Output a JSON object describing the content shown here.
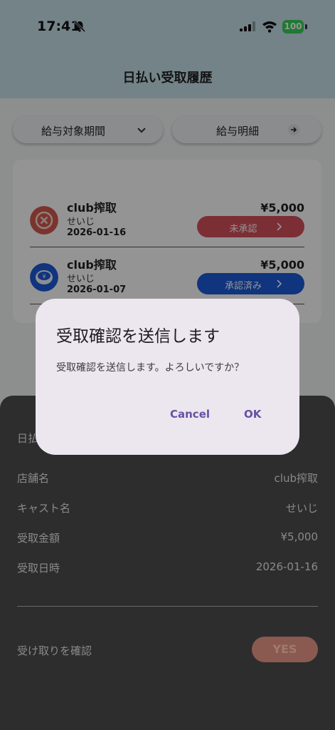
{
  "status_bar": {
    "time": "17:41",
    "battery": "100"
  },
  "header": {
    "title": "日払い受取履歴"
  },
  "filters": {
    "period_label": "給与対象期間",
    "payslip_label": "給与明細"
  },
  "entries": [
    {
      "store": "club搾取",
      "cast": "せいじ",
      "date": "2026-01-16",
      "amount": "¥5,000",
      "status": "未承認",
      "status_color": "#d6505c",
      "icon": "x-circle-icon",
      "icon_color": "#d55a4f"
    },
    {
      "store": "club搾取",
      "cast": "せいじ",
      "date": "2026-01-07",
      "amount": "¥5,000",
      "status": "承認済み",
      "status_color": "#1c5ad8",
      "icon": "yen-coin-icon",
      "icon_color": "#1c5ad8"
    }
  ],
  "sheet": {
    "title": "日払",
    "rows": [
      {
        "label": "店舗名",
        "value": "club搾取"
      },
      {
        "label": "キャスト名",
        "value": "せいじ"
      },
      {
        "label": "受取金額",
        "value": "¥5,000"
      },
      {
        "label": "受取日時",
        "value": "2026-01-16"
      }
    ],
    "confirm_label": "受け取りを確認",
    "yes_label": "YES"
  },
  "dialog": {
    "title": "受取確認を送信します",
    "message": "受取確認を送信します。よろしいですか？",
    "cancel_label": "Cancel",
    "ok_label": "OK"
  },
  "colors": {
    "header_bg": "#c6e2ea",
    "dialog_bg": "#ece6ef",
    "dialog_accent": "#6750a4",
    "sheet_bg": "#2d2d2d"
  }
}
